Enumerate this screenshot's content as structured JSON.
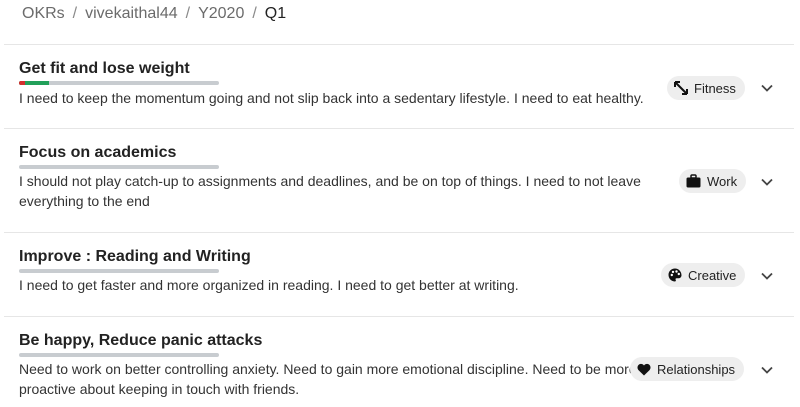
{
  "breadcrumb": {
    "items": [
      "OKRs",
      "vivekaithal44",
      "Y2020"
    ],
    "current": "Q1",
    "separator": "/"
  },
  "okrs": [
    {
      "title": "Get fit and lose weight",
      "description": "I need to keep the momentum going and not slip back into a sedentary lifestyle. I need to eat healthy.",
      "tag": "Fitness",
      "tag_icon": "expand-arrows-icon",
      "progress": 0.15
    },
    {
      "title": "Focus on academics",
      "description": "I should not play catch-up to assignments and deadlines, and be on top of things. I need to not leave everything to the end",
      "tag": "Work",
      "tag_icon": "briefcase-icon",
      "progress": 0
    },
    {
      "title": "Improve : Reading and Writing",
      "description": "I need to get faster and more organized in reading. I need to get better at writing.",
      "tag": "Creative",
      "tag_icon": "palette-icon",
      "progress": 0
    },
    {
      "title": "Be happy, Reduce panic attacks",
      "description": "Need to work on better controlling anxiety. Need to gain more emotional discipline. Need to be more proactive about keeping in touch with friends.",
      "tag": "Relationships",
      "tag_icon": "heart-icon",
      "progress": 0
    }
  ],
  "colors": {
    "progress_track": "#c8ccd0",
    "progress_fill": "#22a05a",
    "progress_start": "#d32f2f",
    "tag_bg": "#eeeeee"
  }
}
